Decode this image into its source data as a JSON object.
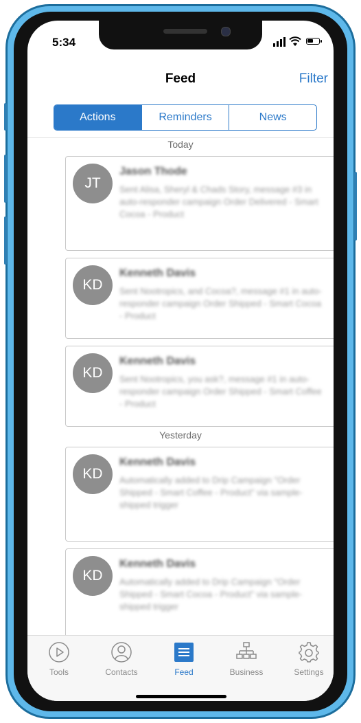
{
  "status_bar": {
    "time": "5:34"
  },
  "nav": {
    "title": "Feed",
    "filter": "Filter"
  },
  "segments": [
    {
      "label": "Actions",
      "active": true
    },
    {
      "label": "Reminders",
      "active": false
    },
    {
      "label": "News",
      "active": false
    }
  ],
  "sections": {
    "today": "Today",
    "yesterday": "Yesterday"
  },
  "feed": [
    {
      "initials": "JT",
      "name": "Jason Thode",
      "message": "Sent Alisa, Sheryl & Chads Story, message #3 in auto-responder campaign Order Delivered - Smart Cocoa - Product"
    },
    {
      "initials": "KD",
      "name": "Kenneth Davis",
      "message": "Sent Nootropics, and Cocoa?, message #1 in auto-responder campaign Order Shipped - Smart Cocoa - Product"
    },
    {
      "initials": "KD",
      "name": "Kenneth Davis",
      "message": "Sent Nootropics, you ask?, message #1 in auto-responder campaign Order Shipped - Smart Coffee - Product"
    },
    {
      "initials": "KD",
      "name": "Kenneth Davis",
      "message": "Automatically added to Drip Campaign \"Order Shipped - Smart Coffee - Product\" via sample-shipped trigger"
    },
    {
      "initials": "KD",
      "name": "Kenneth Davis",
      "message": "Automatically added to Drip Campaign \"Order Shipped - Smart Cocoa - Product\" via sample-shipped trigger"
    }
  ],
  "tabs": [
    {
      "label": "Tools",
      "icon": "play-circle-icon"
    },
    {
      "label": "Contacts",
      "icon": "person-circle-icon"
    },
    {
      "label": "Feed",
      "icon": "list-icon",
      "active": true
    },
    {
      "label": "Business",
      "icon": "org-chart-icon"
    },
    {
      "label": "Settings",
      "icon": "gear-icon"
    }
  ],
  "colors": {
    "accent": "#2b79c9",
    "frame": "#5eb8ea",
    "avatar": "#8e8e8e"
  }
}
